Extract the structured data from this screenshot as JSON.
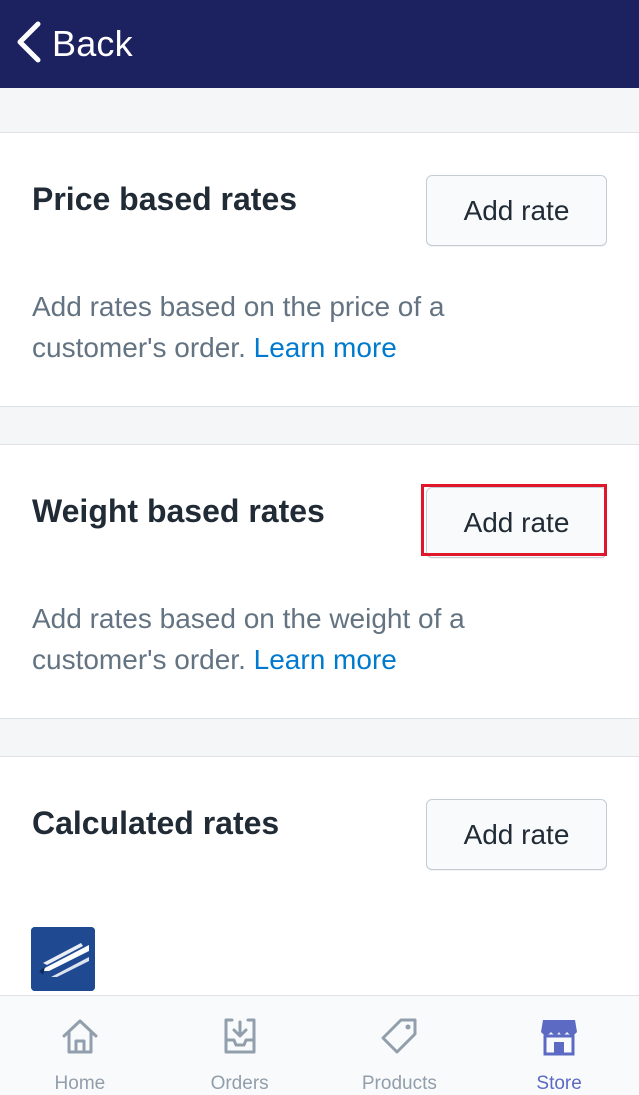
{
  "header": {
    "back_label": "Back",
    "background": "#1c2260"
  },
  "sections": [
    {
      "title": "Price based rates",
      "button_label": "Add rate",
      "description": "Add rates based on the price of a customer's order.",
      "link_label": "Learn more"
    },
    {
      "title": "Weight based rates",
      "button_label": "Add rate",
      "description": "Add rates based on the weight of a customer's order.",
      "link_label": "Learn more",
      "highlighted": true
    },
    {
      "title": "Calculated rates",
      "button_label": "Add rate",
      "carrier_icon": "usps-eagle-icon"
    }
  ],
  "tabbar": {
    "items": [
      {
        "label": "Home",
        "icon": "home-icon",
        "active": false
      },
      {
        "label": "Orders",
        "icon": "orders-inbox-icon",
        "active": false
      },
      {
        "label": "Products",
        "icon": "tag-icon",
        "active": false
      },
      {
        "label": "Store",
        "icon": "store-icon",
        "active": true
      }
    ]
  },
  "colors": {
    "accent": "#5c6ac4",
    "link": "#007ace",
    "highlight_border": "#e0162b",
    "text": "#212b36",
    "muted_text": "#637381"
  }
}
